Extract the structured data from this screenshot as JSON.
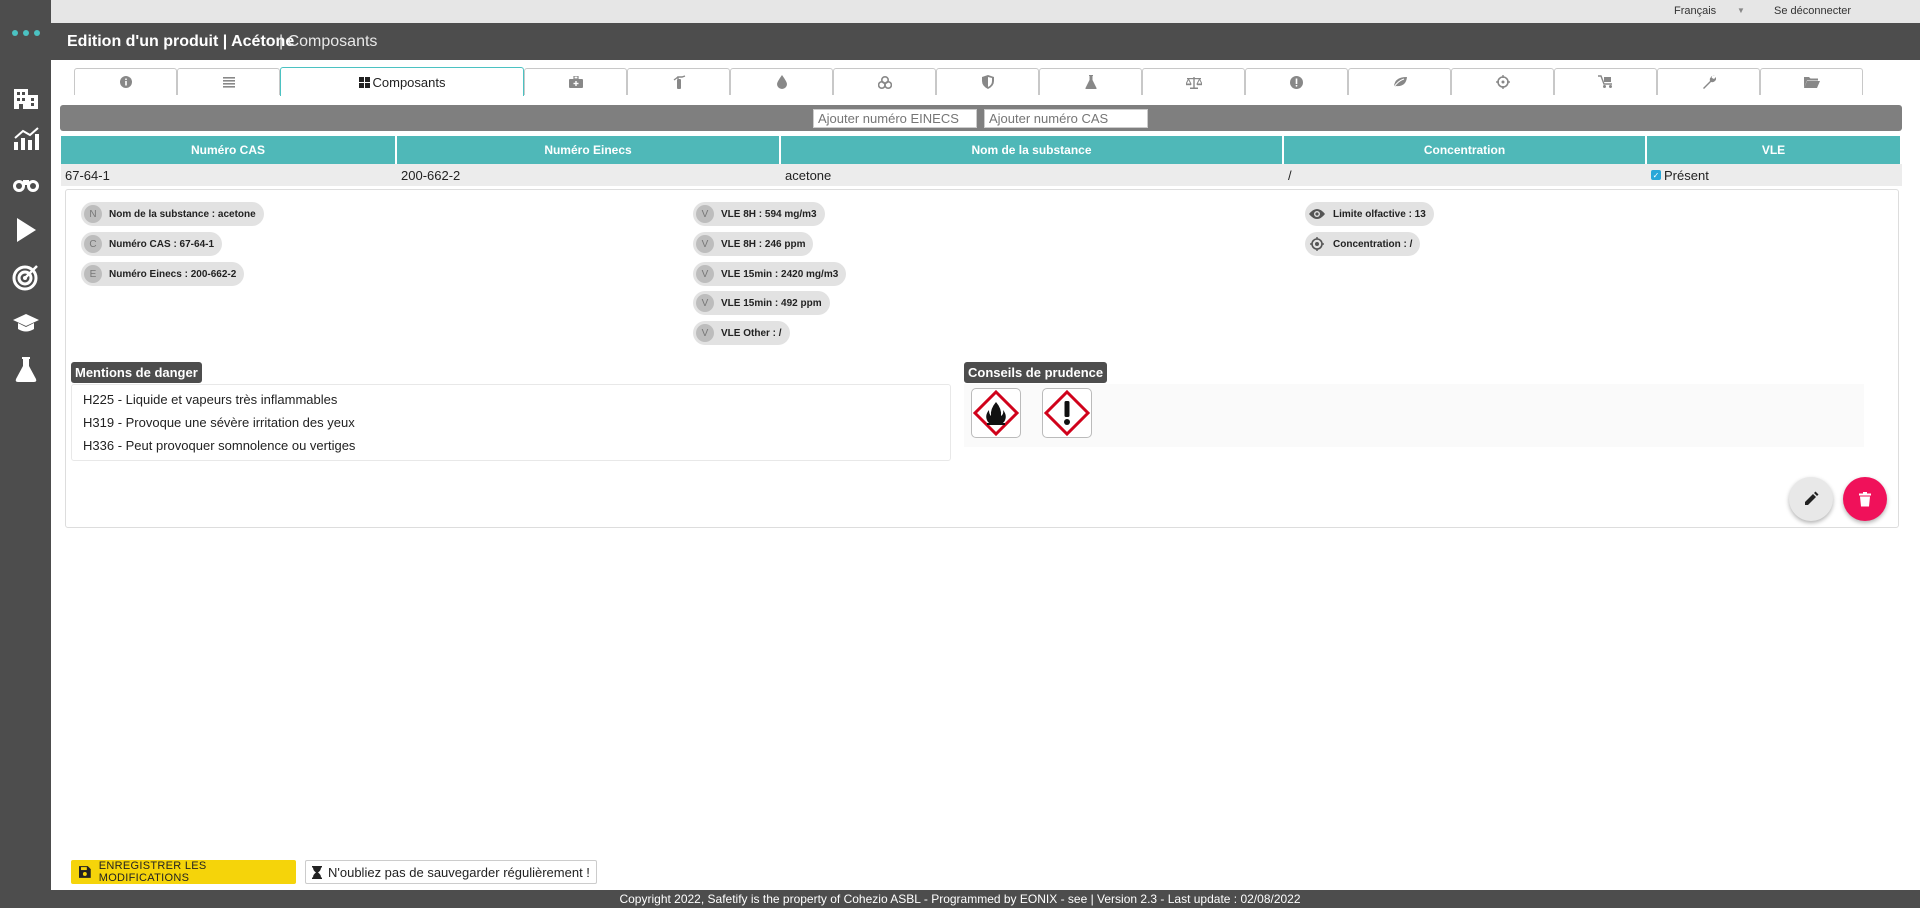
{
  "topbar": {
    "language": "Français",
    "logout": "Se déconnecter"
  },
  "header": {
    "title": "Edition d'un produit | Acétone",
    "section": "| Composants"
  },
  "sidebar": {
    "items": [
      "building-icon",
      "chart-icon",
      "binoculars-icon",
      "play-icon",
      "target-icon",
      "graduation-icon",
      "flask-icon"
    ]
  },
  "tabs": {
    "active_label": "Composants",
    "icons": [
      "info-icon",
      "list-icon",
      "components-icon",
      "medkit-icon",
      "extinguisher-icon",
      "drop-icon",
      "biohazard-icon",
      "shield-icon",
      "flask-icon",
      "scale-icon",
      "exclamation-icon",
      "leaf-icon",
      "crosshair-icon",
      "cart-icon",
      "wrench-icon",
      "folder-icon"
    ]
  },
  "addbar": {
    "einecs_placeholder": "Ajouter numéro EINECS",
    "cas_placeholder": "Ajouter numéro CAS"
  },
  "table": {
    "headers": [
      "Numéro CAS",
      "Numéro Einecs",
      "Nom de la substance",
      "Concentration",
      "VLE"
    ],
    "row": {
      "cas": "67-64-1",
      "einecs": "200-662-2",
      "name": "acetone",
      "concentration": "/",
      "vle": "Présent"
    }
  },
  "detail": {
    "col1": [
      {
        "letter": "N",
        "text": "Nom de la substance : acetone"
      },
      {
        "letter": "C",
        "text": "Numéro CAS : 67-64-1"
      },
      {
        "letter": "E",
        "text": "Numéro Einecs : 200-662-2"
      }
    ],
    "col2": [
      {
        "letter": "V",
        "text": "VLE 8H : 594 mg/m3"
      },
      {
        "letter": "V",
        "text": "VLE 8H : 246 ppm"
      },
      {
        "letter": "V",
        "text": "VLE 15min : 2420 mg/m3"
      },
      {
        "letter": "V",
        "text": "VLE 15min : 492 ppm"
      },
      {
        "letter": "V",
        "text": "VLE Other : /"
      }
    ],
    "col3": [
      {
        "icon": "eye-icon",
        "text": "Limite olfactive : 13"
      },
      {
        "icon": "target-icon",
        "text": "Concentration : /"
      }
    ],
    "danger_title": "Mentions de danger",
    "danger_lines": [
      "H225 - Liquide et vapeurs très inflammables",
      "H319 - Provoque une sévère irritation des yeux",
      "H336 - Peut provoquer somnolence ou vertiges"
    ],
    "prudence_title": "Conseils de prudence",
    "pictograms": [
      "flame-pictogram",
      "exclamation-pictogram"
    ]
  },
  "actions": {
    "edit": "edit-icon",
    "delete": "trash-icon"
  },
  "bottom": {
    "save_label": "ENREGISTRER LES MODIFICATIONS",
    "reminder": "N'oubliez pas de sauvegarder régulièrement !"
  },
  "footer": {
    "text": "Copyright 2022, Safetify is the property of Cohezio ASBL - Programmed by EONIX - see | Version 2.3 - Last update : 02/08/2022"
  },
  "colors": {
    "teal": "#4fb8b8",
    "dark": "#4d4d4d",
    "yellow": "#f5d40a",
    "delete_red": "#f0115a"
  }
}
